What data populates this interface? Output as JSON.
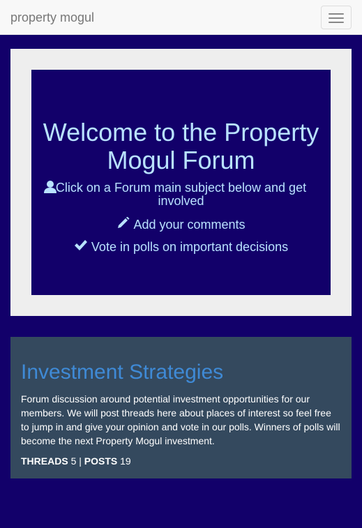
{
  "navbar": {
    "brand": "property mogul",
    "toggle_icon": "hamburger-menu-icon"
  },
  "welcome": {
    "title": "Welcome to the Property Mogul Forum",
    "items": [
      {
        "icon": "user-icon",
        "text": "Click on a Forum main subject below and get involved"
      },
      {
        "icon": "pencil-icon",
        "text": "Add your comments"
      },
      {
        "icon": "checkmark-icon",
        "text": "Vote in polls on important decisions"
      }
    ]
  },
  "forums": [
    {
      "title": "Investment Strategies",
      "description": "Forum discussion around potential investment opportunities for our members.  We will post threads here about places of interest so feel free to jump in and give your opinion and vote in our polls.  Winners of polls will become the next Property Mogul investment.",
      "threads_label": "THREADS",
      "threads": "5",
      "separator": "|",
      "posts_label": "POSTS",
      "posts": "19"
    }
  ],
  "colors": {
    "page_background": "#12006a",
    "navbar_background": "#f8f8f8",
    "jumbotron_frame": "#eeeeee",
    "welcome_text": "#b9e2ff",
    "card_background": "#34495e",
    "forum_link": "#3f8ad6"
  }
}
